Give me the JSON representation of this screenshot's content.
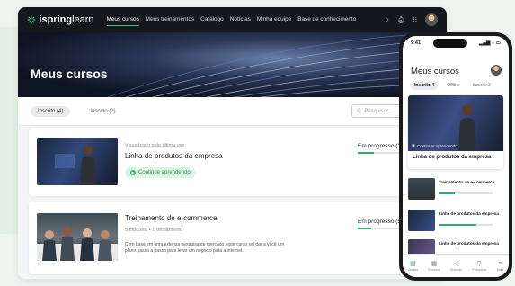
{
  "brand": {
    "name_regular": "i",
    "name_bold": "spring",
    "name_tail": " learn",
    "accent": "#35c27a"
  },
  "nav": {
    "items": [
      "Meus cursos",
      "Meus treinamentos",
      "Catálogo",
      "Notícias",
      "Minha equipe",
      "Base de conhecimento"
    ],
    "active": "Meus cursos",
    "icons": [
      "circle-icon",
      "bell-icon",
      "grid-icon",
      "avatar"
    ]
  },
  "hero": {
    "title": "Meus cursos"
  },
  "tabs": [
    {
      "label": "Inscrito (4)",
      "active": true
    },
    {
      "label": "Inscrito (2)",
      "active": false
    }
  ],
  "search": {
    "placeholder": "Pesquisar..."
  },
  "courses": [
    {
      "meta": "Visualizado pela última vez",
      "title": "Linha de produtos da empresa",
      "action": "Continue aprendendo",
      "progress_label": "Em progresso (1",
      "progress": 0.3
    },
    {
      "title": "Treinamento de e-commerce",
      "meta": "5 módulos • 1 treinamento",
      "description": "Com base em uma extensa pesquisa de mercado, este curso vai dar a você um plano passo a passo para levar um negócio para a internet.",
      "progress_label": "Em progresso (5",
      "progress": 0.25
    }
  ],
  "phone": {
    "time": "9:41",
    "title": "Meus cursos",
    "tabs": [
      {
        "label": "Inscrito 4",
        "active": true
      },
      {
        "label": "Offline",
        "active": false
      },
      {
        "label": "Inscrito 2",
        "active": false
      }
    ],
    "featured": {
      "badge": "Continuar aprendendo",
      "title": "Linha de produtos da empresa"
    },
    "items": [
      {
        "title": "Treinamento de e-commerce",
        "progress": 0.3
      },
      {
        "title": "Linha de produtos da empresa",
        "progress": 0.7
      },
      {
        "title": "Linha de produtos da empresa",
        "progress": 0
      }
    ],
    "bottom_nav": [
      {
        "label": "Cursos",
        "icon": "book-icon",
        "active": true
      },
      {
        "label": "Eventos",
        "icon": "calendar-icon",
        "active": false
      },
      {
        "label": "Notícias",
        "icon": "megaphone-icon",
        "active": false
      },
      {
        "label": "Pesquisar",
        "icon": "search-icon",
        "active": false
      },
      {
        "label": "Mais",
        "icon": "menu-icon",
        "active": false
      }
    ]
  }
}
